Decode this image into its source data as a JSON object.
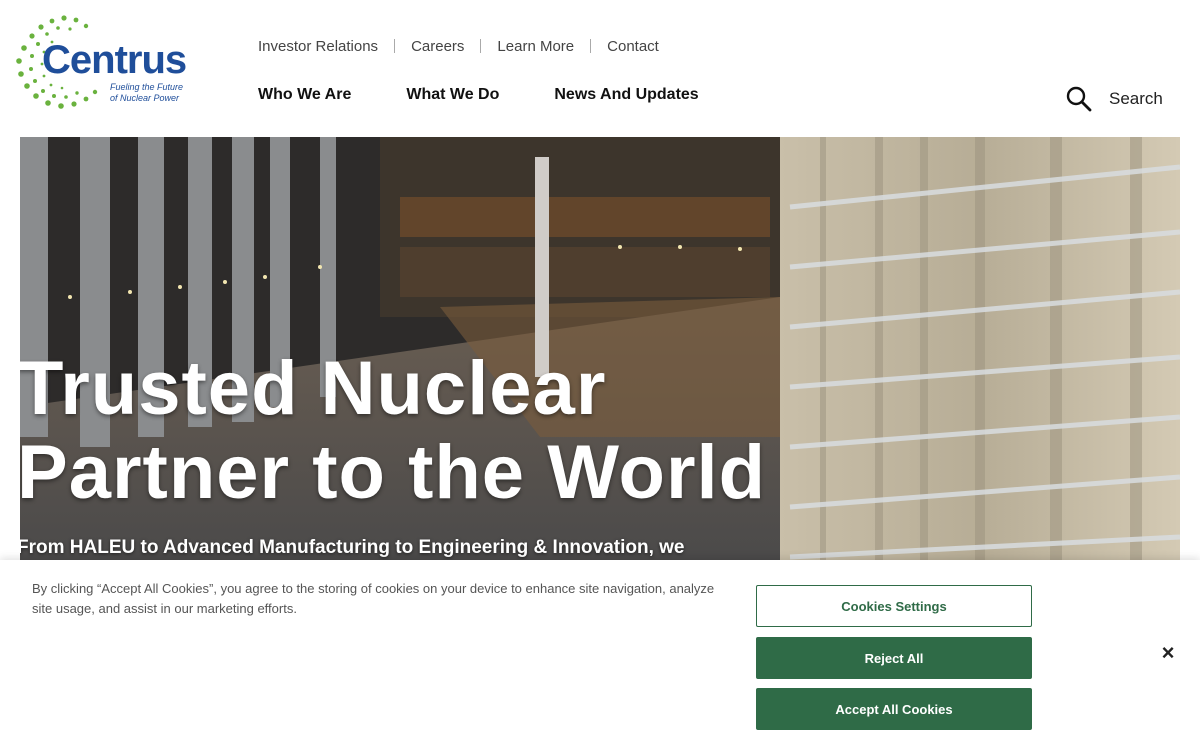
{
  "brand": {
    "name": "Centrus",
    "tagline_line1": "Fueling the Future",
    "tagline_line2": "of Nuclear Power",
    "primary_color": "#1f4e9a",
    "dot_color": "#6ab23e"
  },
  "utility_nav": {
    "items": [
      {
        "label": "Investor Relations"
      },
      {
        "label": "Careers"
      },
      {
        "label": "Learn More"
      },
      {
        "label": "Contact"
      }
    ]
  },
  "main_nav": {
    "items": [
      {
        "label": "Who We Are"
      },
      {
        "label": "What We Do"
      },
      {
        "label": "News And Updates"
      }
    ]
  },
  "search": {
    "label": "Search",
    "icon": "search-icon"
  },
  "hero": {
    "title_line1": "Trusted Nuclear",
    "title_line2": "Partner to the World",
    "subtitle": "From HALEU to Advanced Manufacturing to Engineering & Innovation, we"
  },
  "cookie_banner": {
    "text": "By clicking “Accept All Cookies”, you agree to the storing of cookies on your device to enhance site navigation, analyze site usage, and assist in our marketing efforts.",
    "settings_label": "Cookies Settings",
    "reject_label": "Reject All",
    "accept_label": "Accept All Cookies",
    "close_icon": "close-icon",
    "close_symbol": "×",
    "button_color": "#2f6b47"
  }
}
